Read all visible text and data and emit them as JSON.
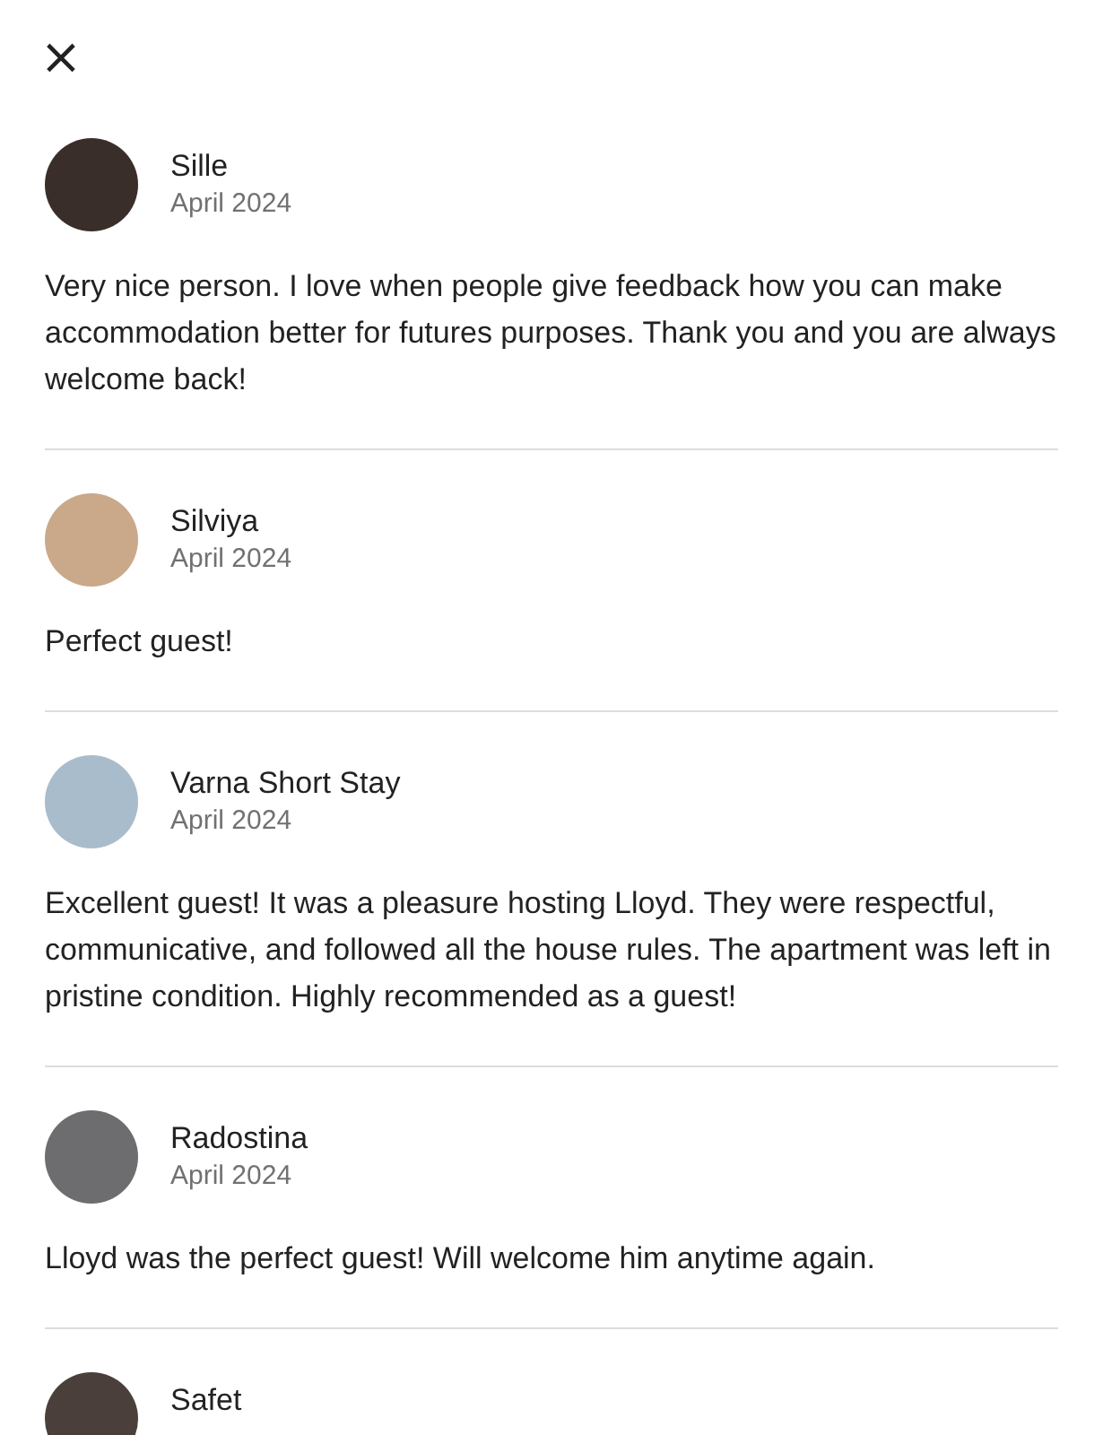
{
  "close_button": {
    "glyph": "×"
  },
  "reviews": [
    {
      "name": "Sille",
      "date": "April 2024",
      "text": "Very nice person. I love when people give feedback how you can make accommodation better for futures purposes. Thank you and you are always welcome back!"
    },
    {
      "name": "Silviya",
      "date": "April 2024",
      "text": "Perfect guest!"
    },
    {
      "name": "Varna Short Stay",
      "date": "April 2024",
      "text": "Excellent guest! It was a pleasure hosting Lloyd. They were respectful, communicative, and followed all the house rules. The apartment was left in pristine condition. Highly recommended as a guest!"
    },
    {
      "name": "Radostina",
      "date": "April 2024",
      "text": "Lloyd was the perfect guest! Will welcome him anytime again."
    },
    {
      "name": "Safet"
    }
  ]
}
